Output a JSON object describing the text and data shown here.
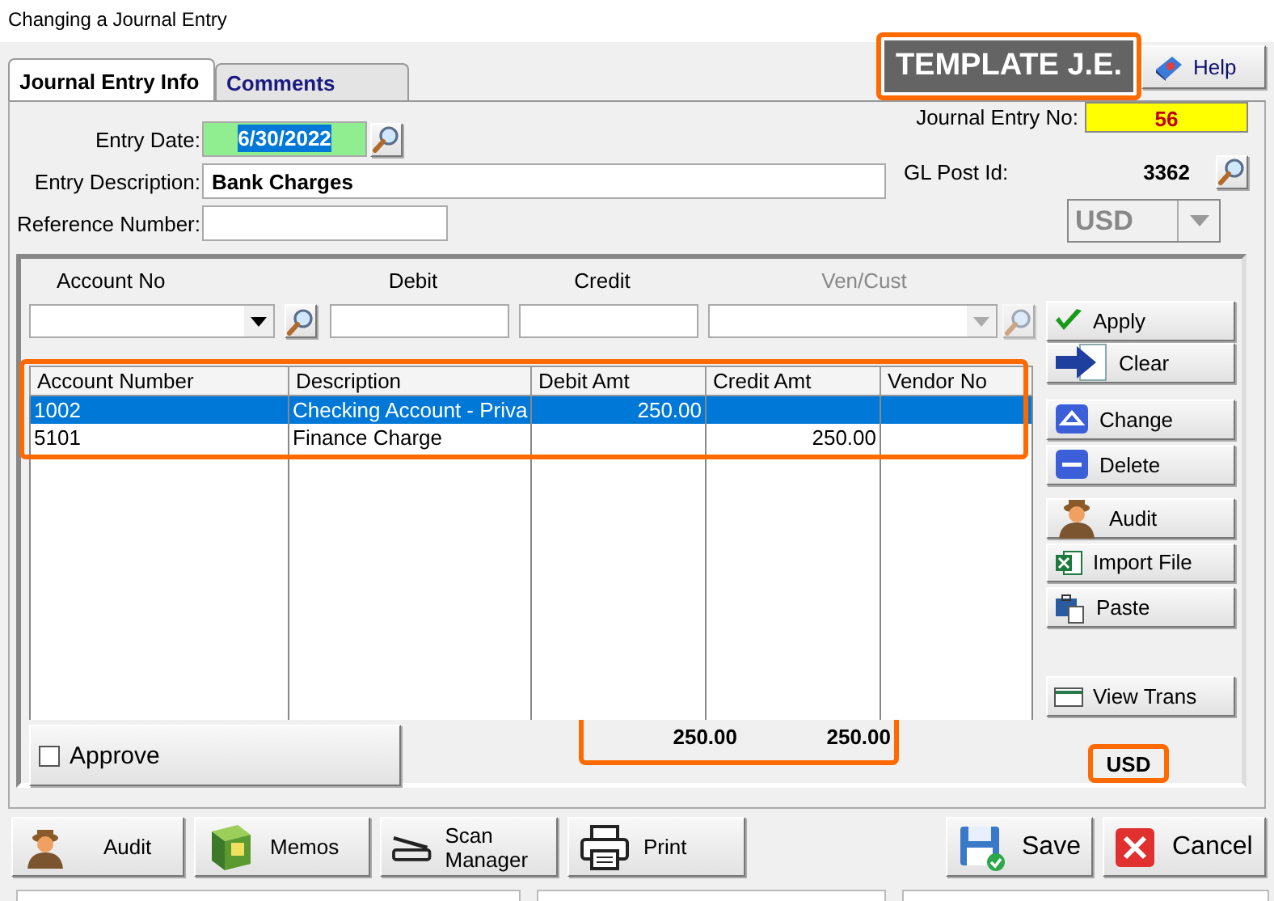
{
  "window": {
    "title": "Changing a Journal Entry"
  },
  "tabs": [
    {
      "label": "Journal Entry Info",
      "selected": true
    },
    {
      "label": "Comments",
      "selected": false
    }
  ],
  "template_badge": "TEMPLATE J.E.",
  "help_button": "Help",
  "form": [
    {
      "label": "Entry Date:",
      "value": "6/30/2022",
      "kind": "date"
    },
    {
      "label": "Entry Description:",
      "value": "Bank Charges",
      "kind": "text"
    },
    {
      "label": "Reference Number:",
      "kind": "short"
    }
  ],
  "journal_entry_no": {
    "label": "Journal Entry No:",
    "value": "56"
  },
  "gl_post_id": {
    "label": "GL Post Id:",
    "value": "3362"
  },
  "currency": {
    "value": "USD",
    "disabled": true
  },
  "entry_line": [
    {
      "label": "Account No",
      "kind": "combo",
      "disabled": false,
      "lookup": true
    },
    {
      "label": "Debit",
      "kind": "text",
      "disabled": false,
      "lookup": false
    },
    {
      "label": "Credit",
      "kind": "text",
      "disabled": false,
      "lookup": false
    },
    {
      "label": "Ven/Cust",
      "kind": "combo",
      "disabled": true,
      "lookup": true
    }
  ],
  "table": {
    "columns": [
      "Account Number",
      "Description",
      "Debit Amt",
      "Credit Amt",
      "Vendor No"
    ],
    "rows": [
      {
        "cells": [
          "1002",
          "Checking Account - Priva",
          "250.00",
          "",
          ""
        ],
        "selected": true
      },
      {
        "cells": [
          "5101",
          "Finance Charge",
          "",
          "250.00",
          ""
        ],
        "selected": false
      }
    ]
  },
  "side_buttons": [
    "Apply",
    "Clear",
    "Change",
    "Delete",
    "Audit",
    "Import File",
    "Paste",
    "View Trans"
  ],
  "approve": {
    "label": "Approve",
    "checked": false
  },
  "totals": {
    "debit": "250.00",
    "credit": "250.00"
  },
  "total_currency": "USD",
  "toolbar_buttons": [
    "Audit",
    "Memos",
    "Scan Manager",
    "Print"
  ],
  "dialog_buttons": [
    "Save",
    "Cancel"
  ]
}
